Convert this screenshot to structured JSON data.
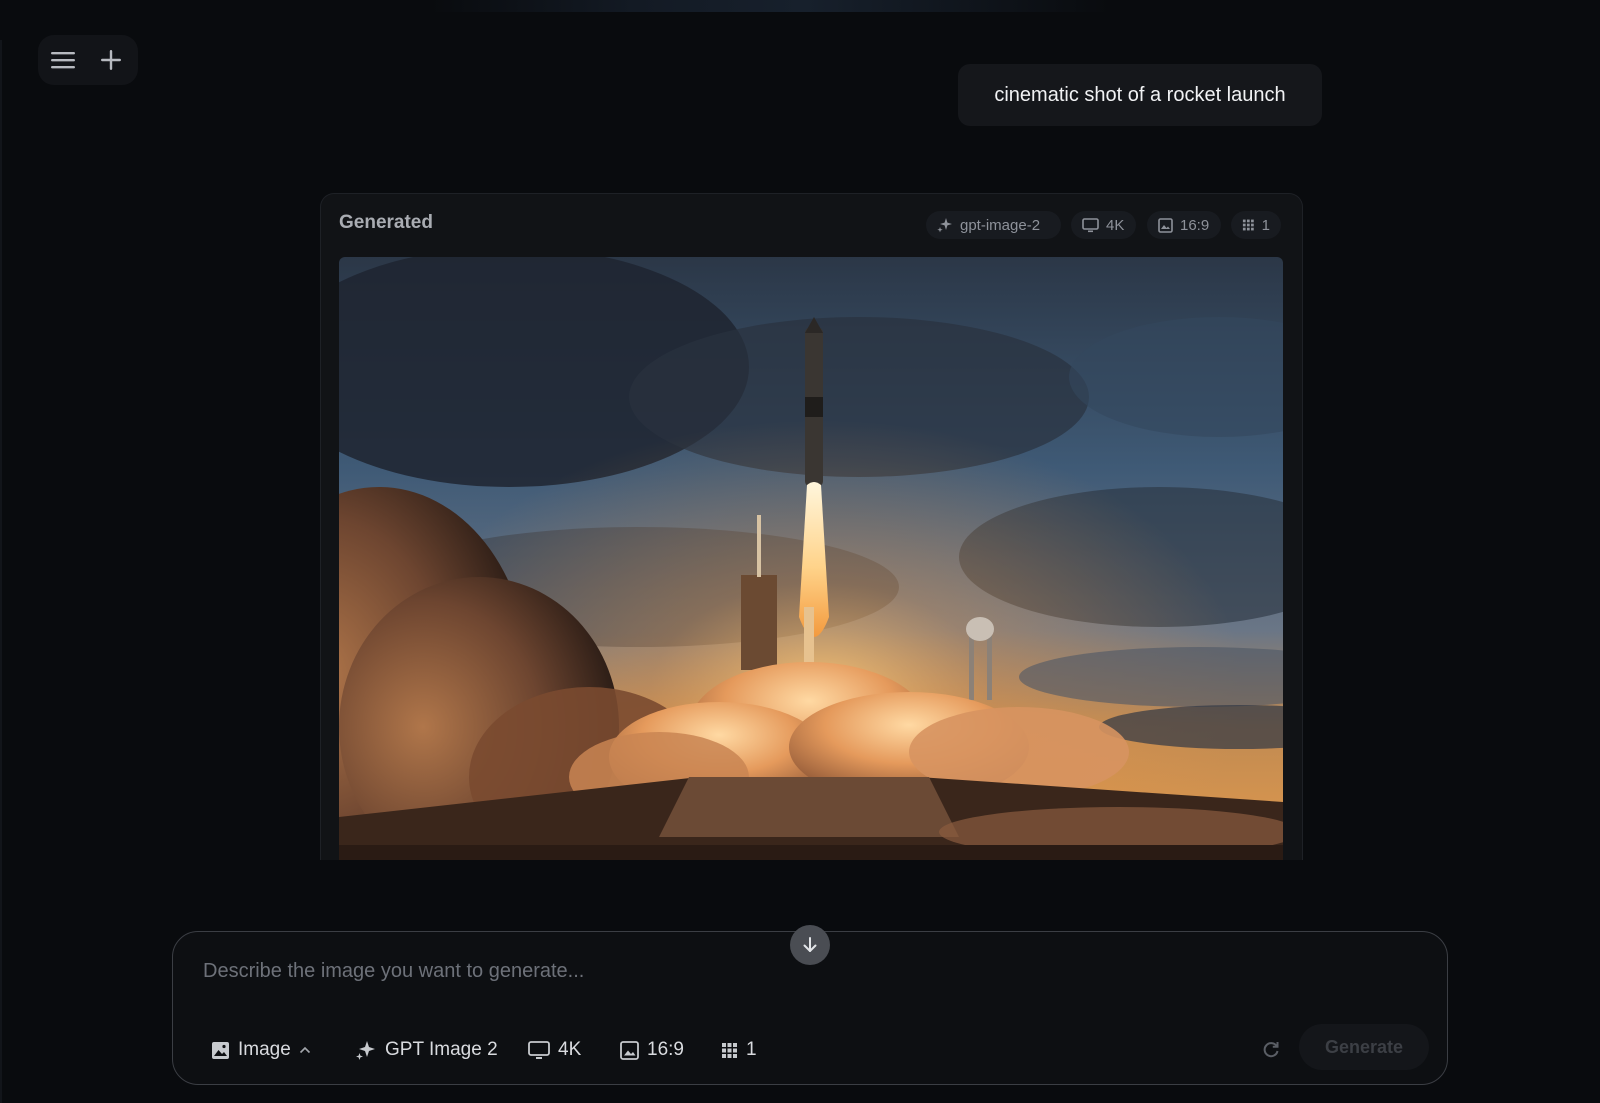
{
  "toolbar": {
    "menu_icon": "hamburger-menu-icon",
    "new_icon": "plus-icon"
  },
  "prompt": {
    "text": "cinematic shot of a rocket launch"
  },
  "result_card": {
    "title": "Generated",
    "chips": {
      "model": "gpt-image-2",
      "resolution": "4K",
      "aspect": "16:9",
      "count": "1"
    },
    "image_description_icon": "rocket-launch-image"
  },
  "composer": {
    "placeholder": "Describe the image you want to generate...",
    "mode_label": "Image",
    "model_label": "GPT Image 2",
    "resolution_label": "4K",
    "aspect_label": "16:9",
    "count_label": "1",
    "generate_label": "Generate"
  },
  "colors": {
    "background": "#090b0e",
    "card": "#111316",
    "composer_border": "#3b3e44",
    "generate_disabled_text": "#3c3f45"
  }
}
